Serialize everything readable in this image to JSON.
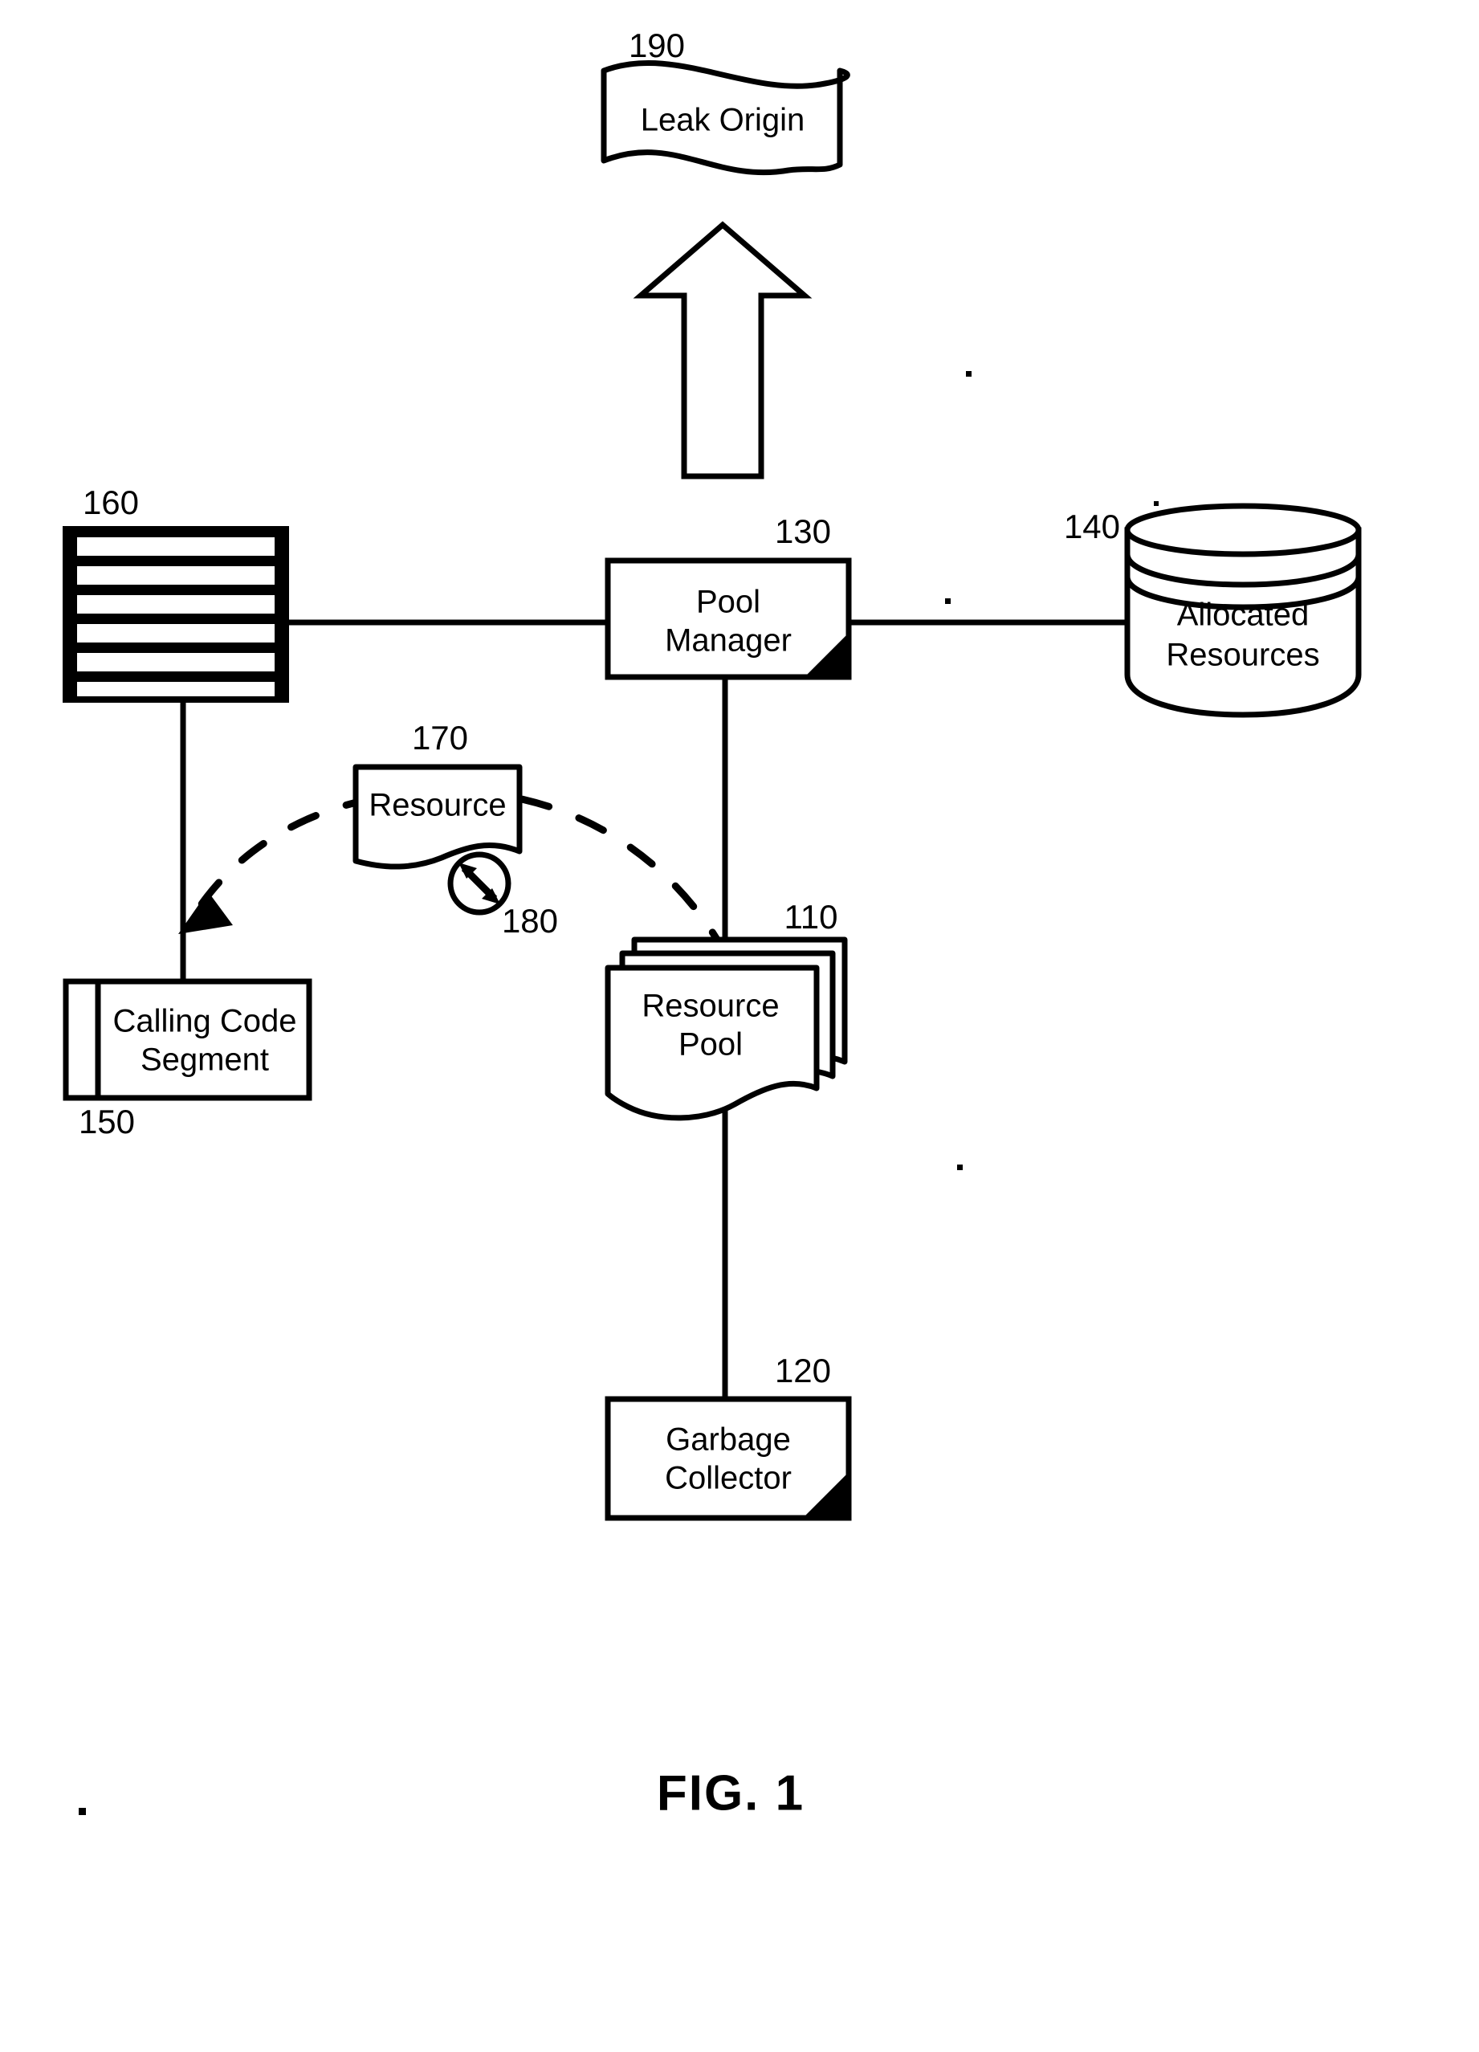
{
  "figure": {
    "caption": "FIG. 1",
    "type": "patent-block-diagram"
  },
  "nodes": [
    {
      "id": "leak-origin",
      "ref": "190",
      "label": "Leak Origin",
      "shape": "wavy-banner"
    },
    {
      "id": "code-listing",
      "ref": "160",
      "label": "",
      "shape": "striped-box",
      "stripes": 6
    },
    {
      "id": "pool-manager",
      "ref": "130",
      "label_line1": "Pool",
      "label_line2": "Manager",
      "shape": "module-box"
    },
    {
      "id": "allocated-resources",
      "ref": "140",
      "label_line1": "Allocated",
      "label_line2": "Resources",
      "shape": "database-cylinder"
    },
    {
      "id": "resource",
      "ref": "170",
      "label": "Resource",
      "shape": "document"
    },
    {
      "id": "timer",
      "ref": "180",
      "label": "",
      "shape": "circle-double-arrow"
    },
    {
      "id": "resource-pool",
      "ref": "110",
      "label_line1": "Resource",
      "label_line2": "Pool",
      "shape": "document-stack"
    },
    {
      "id": "calling-code-segment",
      "ref": "150",
      "label_line1": "Calling Code",
      "label_line2": "Segment",
      "shape": "predefined-process"
    },
    {
      "id": "garbage-collector",
      "ref": "120",
      "label_line1": "Garbage",
      "label_line2": "Collector",
      "shape": "module-box"
    }
  ],
  "edges": [
    {
      "id": "e-codelisting-poolmanager",
      "from": "code-listing",
      "to": "pool-manager",
      "style": "solid"
    },
    {
      "id": "e-poolmanager-allocated",
      "from": "pool-manager",
      "to": "allocated-resources",
      "style": "solid"
    },
    {
      "id": "e-poolmanager-resourcepool",
      "from": "pool-manager",
      "to": "resource-pool",
      "style": "solid"
    },
    {
      "id": "e-resourcepool-garbagecollector",
      "from": "resource-pool",
      "to": "garbage-collector",
      "style": "solid"
    },
    {
      "id": "e-codelisting-callingcode",
      "from": "code-listing",
      "to": "calling-code-segment",
      "style": "solid"
    },
    {
      "id": "e-resourcepool-callingcode",
      "from": "resource-pool",
      "to": "calling-code-segment",
      "style": "dashed-arc-arrow"
    },
    {
      "id": "e-up-to-leakorigin",
      "from": "pool-manager",
      "to": "leak-origin",
      "style": "hollow-block-arrow"
    }
  ],
  "colors": {
    "ink": "#000000",
    "paper": "#ffffff"
  }
}
